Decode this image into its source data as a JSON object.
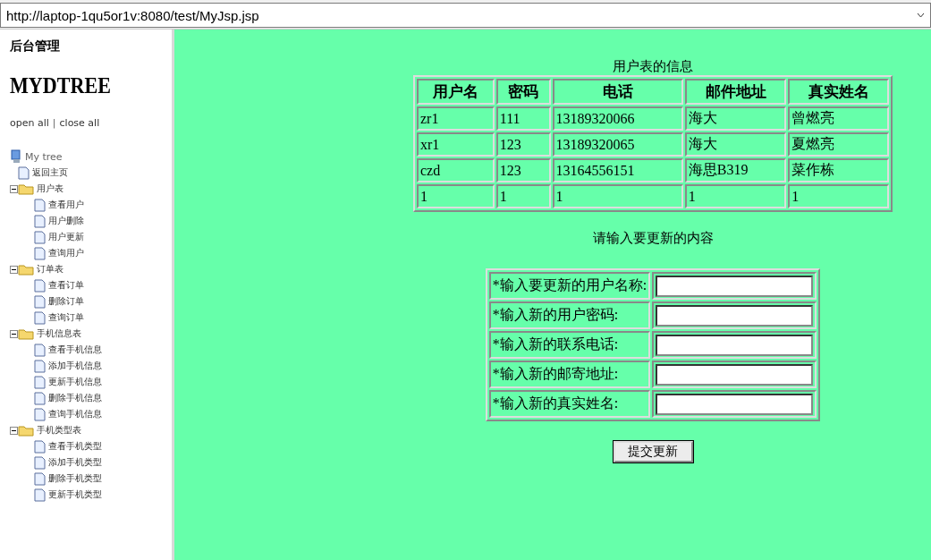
{
  "address_bar": {
    "url": "http://laptop-1qu5or1v:8080/test/MyJsp.jsp"
  },
  "sidebar": {
    "heading": "后台管理",
    "logo": "MYDTREE",
    "open_all": "open all",
    "separator": "|",
    "close_all": "close all",
    "tree": {
      "label": "My tree",
      "children": [
        {
          "kind": "page",
          "label": "返回主页"
        },
        {
          "kind": "folder",
          "label": "用户表",
          "expanded": true,
          "children": [
            {
              "kind": "page",
              "label": "查看用户"
            },
            {
              "kind": "page",
              "label": "用户删除"
            },
            {
              "kind": "page",
              "label": "用户更新"
            },
            {
              "kind": "page",
              "label": "查询用户"
            }
          ]
        },
        {
          "kind": "folder",
          "label": "订单表",
          "expanded": true,
          "children": [
            {
              "kind": "page",
              "label": "查看订单"
            },
            {
              "kind": "page",
              "label": "删除订单"
            },
            {
              "kind": "page",
              "label": "查询订单"
            }
          ]
        },
        {
          "kind": "folder",
          "label": "手机信息表",
          "expanded": true,
          "children": [
            {
              "kind": "page",
              "label": "查看手机信息"
            },
            {
              "kind": "page",
              "label": "添加手机信息"
            },
            {
              "kind": "page",
              "label": "更新手机信息"
            },
            {
              "kind": "page",
              "label": "删除手机信息"
            },
            {
              "kind": "page",
              "label": "查询手机信息"
            }
          ]
        },
        {
          "kind": "folder",
          "label": "手机类型表",
          "expanded": true,
          "children": [
            {
              "kind": "page",
              "label": "查看手机类型"
            },
            {
              "kind": "page",
              "label": "添加手机类型"
            },
            {
              "kind": "page",
              "label": "删除手机类型"
            },
            {
              "kind": "page",
              "label": "更新手机类型"
            }
          ]
        }
      ]
    }
  },
  "user_table": {
    "caption": "用户表的信息",
    "columns": [
      "用户名",
      "密码",
      "电话",
      "邮件地址",
      "真实姓名"
    ],
    "rows": [
      [
        "zr1",
        "111",
        "13189320066",
        "海大",
        "曾燃亮"
      ],
      [
        "xr1",
        "123",
        "13189320065",
        "海大",
        "夏燃亮"
      ],
      [
        "czd",
        "123",
        "13164556151",
        "海思B319",
        "菜作栋"
      ],
      [
        "1",
        "1",
        "1",
        "1",
        "1"
      ]
    ]
  },
  "update_form": {
    "title": "请输入要更新的内容",
    "fields": [
      {
        "label": "*输入要更新的用户名称:"
      },
      {
        "label": "*输入新的用户密码:"
      },
      {
        "label": "*输入新的联系电话:"
      },
      {
        "label": "*输入新的邮寄地址:"
      },
      {
        "label": "*输入新的真实姓名:"
      }
    ],
    "submit": "提交更新"
  }
}
